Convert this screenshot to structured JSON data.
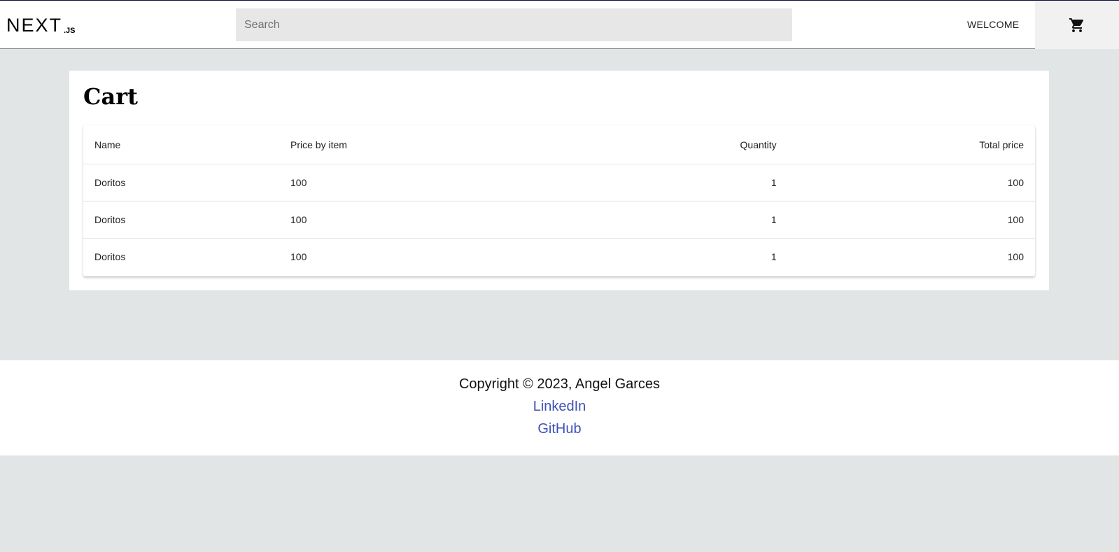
{
  "header": {
    "logo_text": "NEXT.js",
    "search_placeholder": "Search",
    "welcome_label": "WELCOME",
    "cart_icon": "shopping-cart-icon"
  },
  "main": {
    "title": "Cart",
    "table": {
      "headers": {
        "name": "Name",
        "price": "Price by item",
        "quantity": "Quantity",
        "total": "Total price"
      },
      "rows": [
        {
          "name": "Doritos",
          "price": "100",
          "quantity": "1",
          "total": "100"
        },
        {
          "name": "Doritos",
          "price": "100",
          "quantity": "1",
          "total": "100"
        },
        {
          "name": "Doritos",
          "price": "100",
          "quantity": "1",
          "total": "100"
        }
      ]
    }
  },
  "footer": {
    "copyright": "Copyright © 2023, Angel Garces",
    "links": {
      "linkedin": "LinkedIn",
      "github": "GitHub"
    }
  },
  "colors": {
    "page_background": "#e1e5e6",
    "link": "#3f51b5",
    "search_background": "#e7e7e7"
  }
}
